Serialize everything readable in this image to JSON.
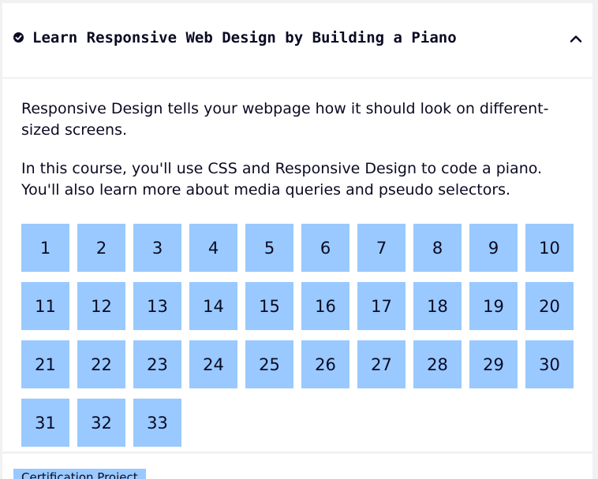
{
  "course": {
    "title": "Learn Responsive Web Design by Building a Piano",
    "completed": true,
    "expanded": true,
    "description_1": "Responsive Design tells your webpage how it should look on different-sized screens.",
    "description_2": "In this course, you'll use CSS and Responsive Design to code a piano. You'll also learn more about media queries and pseudo selectors.",
    "steps": [
      "1",
      "2",
      "3",
      "4",
      "5",
      "6",
      "7",
      "8",
      "9",
      "10",
      "11",
      "12",
      "13",
      "14",
      "15",
      "16",
      "17",
      "18",
      "19",
      "20",
      "21",
      "22",
      "23",
      "24",
      "25",
      "26",
      "27",
      "28",
      "29",
      "30",
      "31",
      "32",
      "33"
    ]
  },
  "next_section": {
    "badge_label": "Certification Project"
  },
  "colors": {
    "step_bg": "#99c9ff",
    "text": "#0a0a23",
    "page_bg": "#f1f1f4",
    "panel_bg": "#ffffff"
  },
  "icons": {
    "completed": "check-circle-icon",
    "toggle": "chevron-up-icon"
  }
}
